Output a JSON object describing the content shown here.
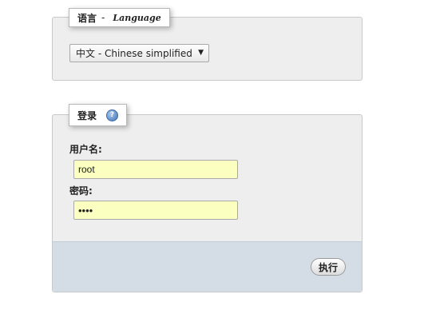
{
  "language_panel": {
    "legend_cn": "语言",
    "legend_dash": "-",
    "legend_en": "Language",
    "select_value": "中文 - Chinese simplified",
    "select_arrow": "▼"
  },
  "login_panel": {
    "legend": "登录",
    "help_glyph": "?",
    "username_label": "用户名:",
    "username_value": "root",
    "password_label": "密码:",
    "password_value_masked": "••••",
    "submit_label": "执行"
  },
  "colors": {
    "input_background": "#fbffbf",
    "footer_background": "#d4dde6",
    "panel_background": "#eeeeee"
  },
  "icons": {
    "help": "help-icon",
    "dropdown": "chevron-down-icon"
  }
}
